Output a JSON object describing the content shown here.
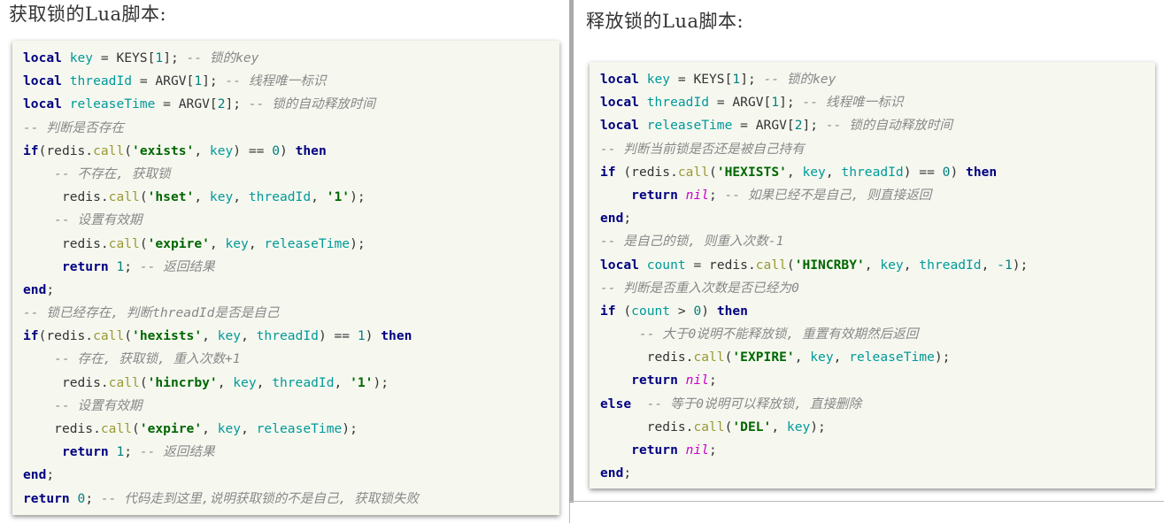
{
  "left_panel": {
    "title": "获取锁的Lua脚本:",
    "lines": [
      [
        [
          "kw",
          "local"
        ],
        [
          "op",
          " "
        ],
        [
          "var",
          "key"
        ],
        [
          "op",
          " = "
        ],
        [
          "id",
          "KEYS"
        ],
        [
          "op",
          "["
        ],
        [
          "num",
          "1"
        ],
        [
          "op",
          "]; "
        ],
        [
          "com",
          "-- 锁的key"
        ]
      ],
      [
        [
          "kw",
          "local"
        ],
        [
          "op",
          " "
        ],
        [
          "var",
          "threadId"
        ],
        [
          "op",
          " = "
        ],
        [
          "id",
          "ARGV"
        ],
        [
          "op",
          "["
        ],
        [
          "num",
          "1"
        ],
        [
          "op",
          "]; "
        ],
        [
          "com",
          "-- 线程唯一标识"
        ]
      ],
      [
        [
          "kw",
          "local"
        ],
        [
          "op",
          " "
        ],
        [
          "var",
          "releaseTime"
        ],
        [
          "op",
          " = "
        ],
        [
          "id",
          "ARGV"
        ],
        [
          "op",
          "["
        ],
        [
          "num",
          "2"
        ],
        [
          "op",
          "]; "
        ],
        [
          "com",
          "-- 锁的自动释放时间"
        ]
      ],
      [
        [
          "com",
          "-- 判断是否存在"
        ]
      ],
      [
        [
          "kw",
          "if"
        ],
        [
          "op",
          "("
        ],
        [
          "fn",
          "redis."
        ],
        [
          "call",
          "call"
        ],
        [
          "op",
          "("
        ],
        [
          "str",
          "'exists'"
        ],
        [
          "op",
          ", "
        ],
        [
          "var",
          "key"
        ],
        [
          "op",
          ") == "
        ],
        [
          "num",
          "0"
        ],
        [
          "op",
          ") "
        ],
        [
          "kw",
          "then"
        ]
      ],
      [
        [
          "op",
          "    "
        ],
        [
          "com",
          "-- 不存在, 获取锁"
        ]
      ],
      [
        [
          "op",
          "     "
        ],
        [
          "fn",
          "redis."
        ],
        [
          "call",
          "call"
        ],
        [
          "op",
          "("
        ],
        [
          "str",
          "'hset'"
        ],
        [
          "op",
          ", "
        ],
        [
          "var",
          "key"
        ],
        [
          "op",
          ", "
        ],
        [
          "var",
          "threadId"
        ],
        [
          "op",
          ", "
        ],
        [
          "str",
          "'1'"
        ],
        [
          "op",
          ");"
        ]
      ],
      [
        [
          "op",
          "    "
        ],
        [
          "com",
          "-- 设置有效期"
        ]
      ],
      [
        [
          "op",
          "     "
        ],
        [
          "fn",
          "redis."
        ],
        [
          "call",
          "call"
        ],
        [
          "op",
          "("
        ],
        [
          "str",
          "'expire'"
        ],
        [
          "op",
          ", "
        ],
        [
          "var",
          "key"
        ],
        [
          "op",
          ", "
        ],
        [
          "var",
          "releaseTime"
        ],
        [
          "op",
          ");"
        ]
      ],
      [
        [
          "op",
          "     "
        ],
        [
          "kw",
          "return"
        ],
        [
          "op",
          " "
        ],
        [
          "num",
          "1"
        ],
        [
          "op",
          "; "
        ],
        [
          "com",
          "-- 返回结果"
        ]
      ],
      [
        [
          "kw",
          "end"
        ],
        [
          "op",
          ";"
        ]
      ],
      [
        [
          "com",
          "-- 锁已经存在, 判断threadId是否是自己"
        ]
      ],
      [
        [
          "kw",
          "if"
        ],
        [
          "op",
          "("
        ],
        [
          "fn",
          "redis."
        ],
        [
          "call",
          "call"
        ],
        [
          "op",
          "("
        ],
        [
          "str",
          "'hexists'"
        ],
        [
          "op",
          ", "
        ],
        [
          "var",
          "key"
        ],
        [
          "op",
          ", "
        ],
        [
          "var",
          "threadId"
        ],
        [
          "op",
          ") == "
        ],
        [
          "num",
          "1"
        ],
        [
          "op",
          ") "
        ],
        [
          "kw",
          "then"
        ]
      ],
      [
        [
          "op",
          "    "
        ],
        [
          "com",
          "-- 存在, 获取锁, 重入次数+1"
        ]
      ],
      [
        [
          "op",
          "     "
        ],
        [
          "fn",
          "redis."
        ],
        [
          "call",
          "call"
        ],
        [
          "op",
          "("
        ],
        [
          "str",
          "'hincrby'"
        ],
        [
          "op",
          ", "
        ],
        [
          "var",
          "key"
        ],
        [
          "op",
          ", "
        ],
        [
          "var",
          "threadId"
        ],
        [
          "op",
          ", "
        ],
        [
          "str",
          "'1'"
        ],
        [
          "op",
          ");"
        ]
      ],
      [
        [
          "op",
          "    "
        ],
        [
          "com",
          "-- 设置有效期"
        ]
      ],
      [
        [
          "op",
          "    "
        ],
        [
          "fn",
          "redis."
        ],
        [
          "call",
          "call"
        ],
        [
          "op",
          "("
        ],
        [
          "str",
          "'expire'"
        ],
        [
          "op",
          ", "
        ],
        [
          "var",
          "key"
        ],
        [
          "op",
          ", "
        ],
        [
          "var",
          "releaseTime"
        ],
        [
          "op",
          ");"
        ]
      ],
      [
        [
          "op",
          "     "
        ],
        [
          "kw",
          "return"
        ],
        [
          "op",
          " "
        ],
        [
          "num",
          "1"
        ],
        [
          "op",
          "; "
        ],
        [
          "com",
          "-- 返回结果"
        ]
      ],
      [
        [
          "kw",
          "end"
        ],
        [
          "op",
          ";"
        ]
      ],
      [
        [
          "kw",
          "return"
        ],
        [
          "op",
          " "
        ],
        [
          "num",
          "0"
        ],
        [
          "op",
          "; "
        ],
        [
          "com",
          "-- 代码走到这里,说明获取锁的不是自己, 获取锁失败"
        ]
      ]
    ]
  },
  "right_panel": {
    "title": "释放锁的Lua脚本:",
    "lines": [
      [
        [
          "kw",
          "local"
        ],
        [
          "op",
          " "
        ],
        [
          "var",
          "key"
        ],
        [
          "op",
          " = "
        ],
        [
          "id",
          "KEYS"
        ],
        [
          "op",
          "["
        ],
        [
          "num",
          "1"
        ],
        [
          "op",
          "]; "
        ],
        [
          "com",
          "-- 锁的key"
        ]
      ],
      [
        [
          "kw",
          "local"
        ],
        [
          "op",
          " "
        ],
        [
          "var",
          "threadId"
        ],
        [
          "op",
          " = "
        ],
        [
          "id",
          "ARGV"
        ],
        [
          "op",
          "["
        ],
        [
          "num",
          "1"
        ],
        [
          "op",
          "]; "
        ],
        [
          "com",
          "-- 线程唯一标识"
        ]
      ],
      [
        [
          "kw",
          "local"
        ],
        [
          "op",
          " "
        ],
        [
          "var",
          "releaseTime"
        ],
        [
          "op",
          " = "
        ],
        [
          "id",
          "ARGV"
        ],
        [
          "op",
          "["
        ],
        [
          "num",
          "2"
        ],
        [
          "op",
          "]; "
        ],
        [
          "com",
          "-- 锁的自动释放时间"
        ]
      ],
      [
        [
          "com",
          "-- 判断当前锁是否还是被自己持有"
        ]
      ],
      [
        [
          "kw",
          "if"
        ],
        [
          "op",
          " ("
        ],
        [
          "fn",
          "redis."
        ],
        [
          "call",
          "call"
        ],
        [
          "op",
          "("
        ],
        [
          "str",
          "'HEXISTS'"
        ],
        [
          "op",
          ", "
        ],
        [
          "var",
          "key"
        ],
        [
          "op",
          ", "
        ],
        [
          "var",
          "threadId"
        ],
        [
          "op",
          ") == "
        ],
        [
          "num",
          "0"
        ],
        [
          "op",
          ") "
        ],
        [
          "kw",
          "then"
        ]
      ],
      [
        [
          "op",
          "    "
        ],
        [
          "kw",
          "return"
        ],
        [
          "op",
          " "
        ],
        [
          "nil",
          "nil"
        ],
        [
          "op",
          "; "
        ],
        [
          "com",
          "-- 如果已经不是自己, 则直接返回"
        ]
      ],
      [
        [
          "kw",
          "end"
        ],
        [
          "op",
          ";"
        ]
      ],
      [
        [
          "com",
          "-- 是自己的锁, 则重入次数-1"
        ]
      ],
      [
        [
          "kw",
          "local"
        ],
        [
          "op",
          " "
        ],
        [
          "var",
          "count"
        ],
        [
          "op",
          " = "
        ],
        [
          "fn",
          "redis."
        ],
        [
          "call",
          "call"
        ],
        [
          "op",
          "("
        ],
        [
          "str",
          "'HINCRBY'"
        ],
        [
          "op",
          ", "
        ],
        [
          "var",
          "key"
        ],
        [
          "op",
          ", "
        ],
        [
          "var",
          "threadId"
        ],
        [
          "op",
          ", "
        ],
        [
          "num",
          "-1"
        ],
        [
          "op",
          ");"
        ]
      ],
      [
        [
          "com",
          "-- 判断是否重入次数是否已经为0"
        ]
      ],
      [
        [
          "kw",
          "if"
        ],
        [
          "op",
          " ("
        ],
        [
          "var",
          "count"
        ],
        [
          "op",
          " > "
        ],
        [
          "num",
          "0"
        ],
        [
          "op",
          ") "
        ],
        [
          "kw",
          "then"
        ]
      ],
      [
        [
          "op",
          "     "
        ],
        [
          "com",
          "-- 大于0说明不能释放锁, 重置有效期然后返回"
        ]
      ],
      [
        [
          "op",
          "      "
        ],
        [
          "fn",
          "redis."
        ],
        [
          "call",
          "call"
        ],
        [
          "op",
          "("
        ],
        [
          "str",
          "'EXPIRE'"
        ],
        [
          "op",
          ", "
        ],
        [
          "var",
          "key"
        ],
        [
          "op",
          ", "
        ],
        [
          "var",
          "releaseTime"
        ],
        [
          "op",
          ");"
        ]
      ],
      [
        [
          "op",
          "    "
        ],
        [
          "kw",
          "return"
        ],
        [
          "op",
          " "
        ],
        [
          "nil",
          "nil"
        ],
        [
          "op",
          ";"
        ]
      ],
      [
        [
          "kw",
          "else"
        ],
        [
          "op",
          "  "
        ],
        [
          "com",
          "-- 等于0说明可以释放锁, 直接删除"
        ]
      ],
      [
        [
          "op",
          "      "
        ],
        [
          "fn",
          "redis."
        ],
        [
          "call",
          "call"
        ],
        [
          "op",
          "("
        ],
        [
          "str",
          "'DEL'"
        ],
        [
          "op",
          ", "
        ],
        [
          "var",
          "key"
        ],
        [
          "op",
          ");"
        ]
      ],
      [
        [
          "op",
          "    "
        ],
        [
          "kw",
          "return"
        ],
        [
          "op",
          " "
        ],
        [
          "nil",
          "nil"
        ],
        [
          "op",
          ";"
        ]
      ],
      [
        [
          "kw",
          "end"
        ],
        [
          "op",
          ";"
        ]
      ]
    ]
  }
}
